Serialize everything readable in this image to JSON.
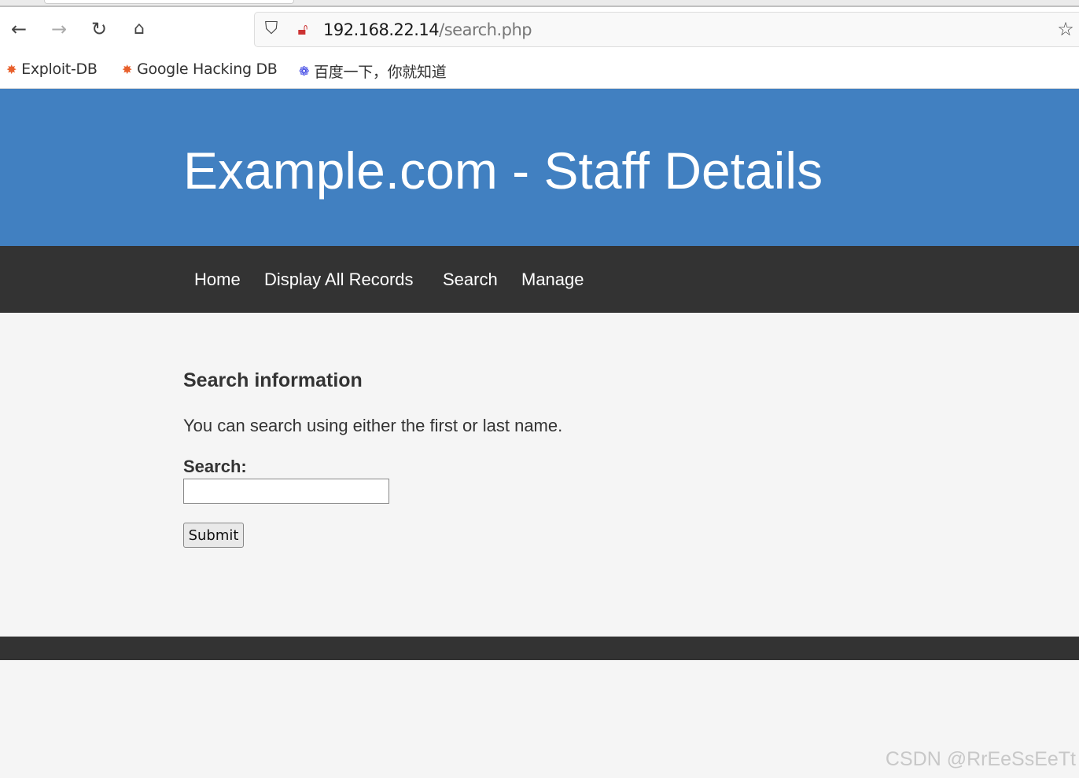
{
  "browser": {
    "url_host": "192.168.22.14",
    "url_path": "/search.php",
    "bookmarks": [
      {
        "label": "Exploit-DB",
        "icon": "bug-icon",
        "color": "#e8602c"
      },
      {
        "label": "Google Hacking DB",
        "icon": "bug-icon",
        "color": "#e8602c"
      },
      {
        "label": "百度一下，你就知道",
        "icon": "paw-icon",
        "color": "#2932e1"
      }
    ]
  },
  "header": {
    "title": "Example.com - Staff Details",
    "color": "#4180c1"
  },
  "nav": {
    "items": [
      "Home",
      "Display All Records",
      "Search",
      "Manage"
    ]
  },
  "main": {
    "heading": "Search information",
    "description": "You can search using either the first or last name.",
    "search_label": "Search:",
    "search_value": "",
    "submit_label": "Submit"
  },
  "watermark": "CSDN @RrEeSsEeTt"
}
